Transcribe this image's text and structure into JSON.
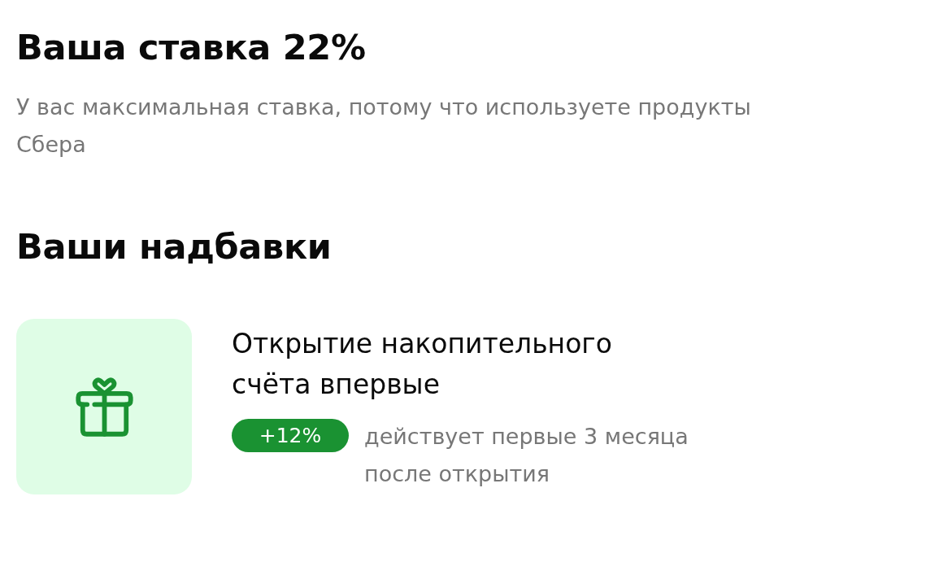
{
  "rate": {
    "title": "Ваша ставка 22%",
    "description": "У вас максимальная ставка, потому что используете продукты Сбера"
  },
  "bonuses": {
    "title": "Ваши надбавки",
    "items": [
      {
        "kind": "gift",
        "title": "Открытие накопительного счёта впервые",
        "badge": "+12%",
        "note": "действует первые 3 месяца после открытия"
      }
    ]
  }
}
